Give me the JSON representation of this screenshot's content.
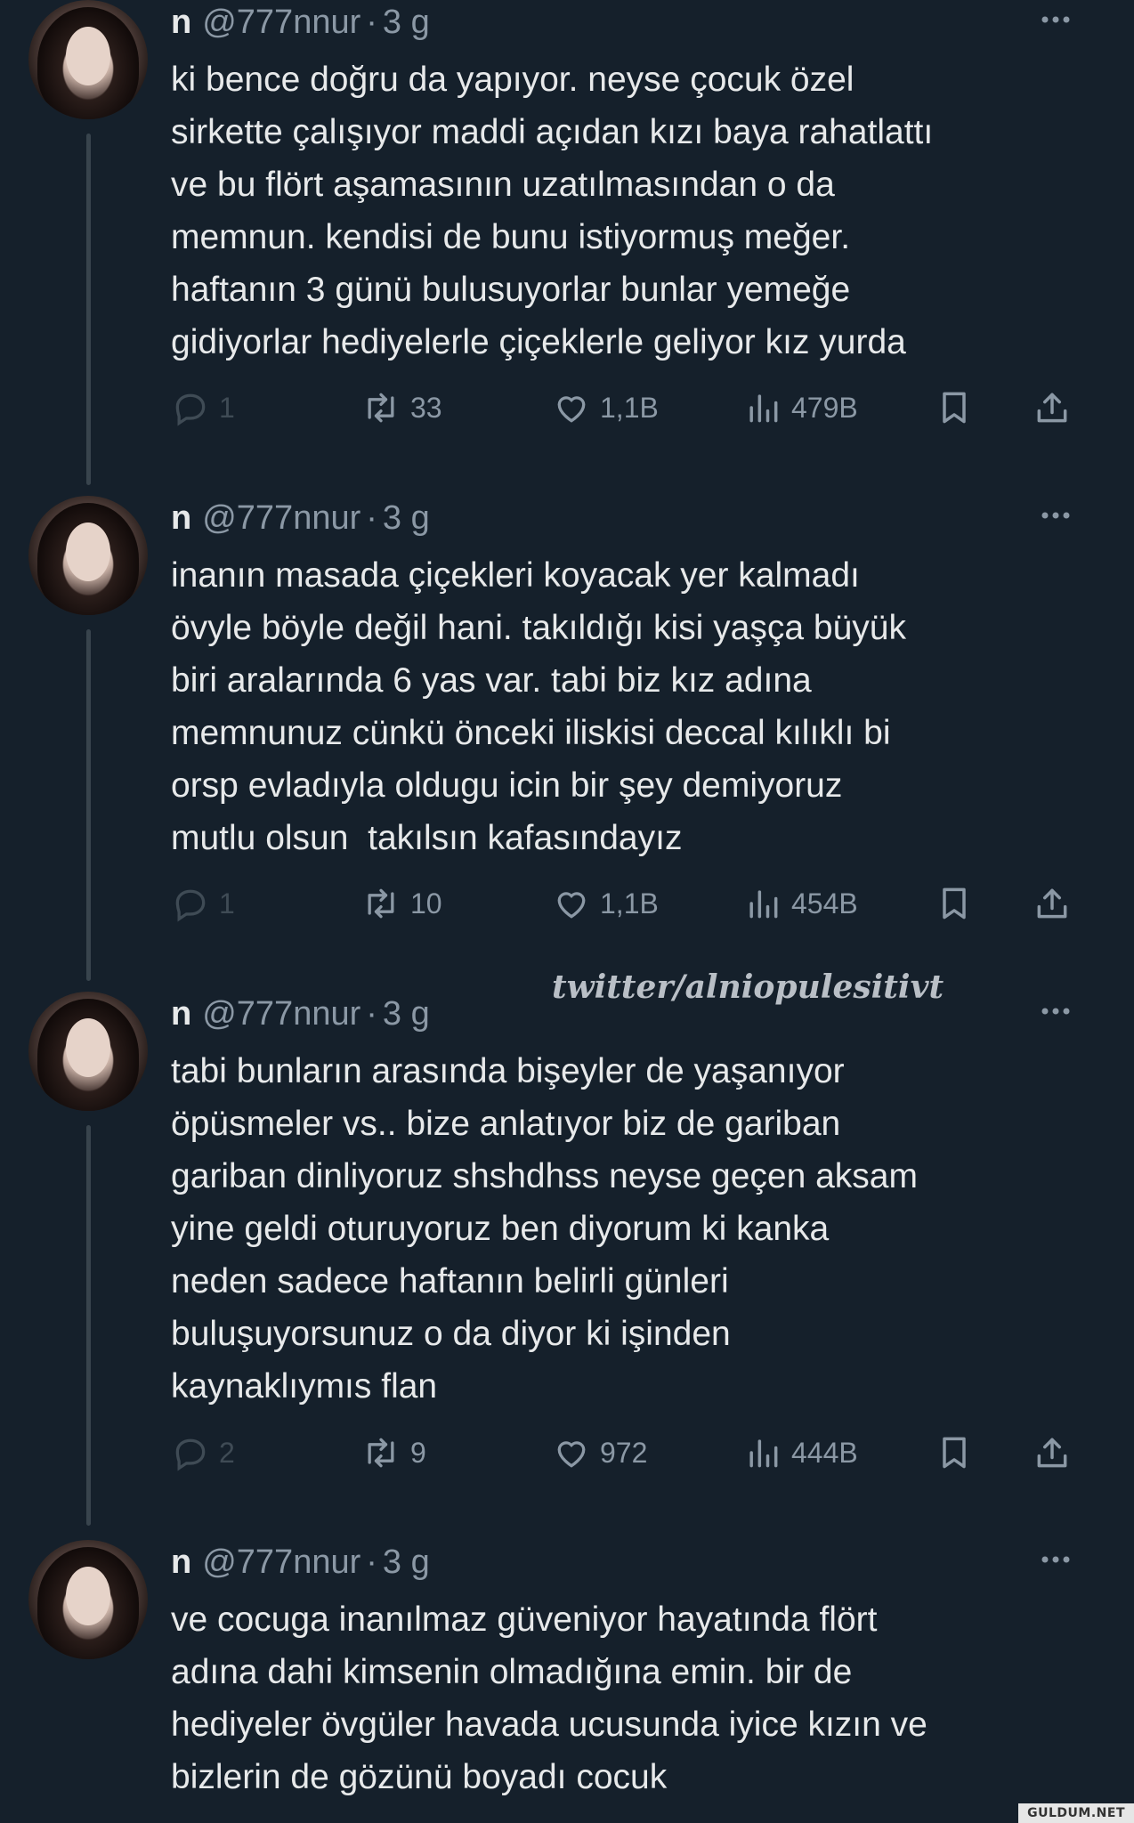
{
  "tweets": [
    {
      "name": "n",
      "handle": "@777nnur",
      "separator": "·",
      "time": "3 g",
      "text": "ki bence doğru da yapıyor. neyse çocuk özel\nsirkette çalışıyor maddi açıdan kızı baya rahatlattı\nve bu flört aşamasının uzatılmasından o da\nmemnun. kendisi de bunu istiyormuş meğer.\nhaftanın 3 günü bulusuyorlar bunlar yemeğe\ngidiyorlar hediyelerle çiçeklerle geliyor kız yurda",
      "replies": "1",
      "retweets": "33",
      "likes": "1,1B",
      "views": "479B"
    },
    {
      "name": "n",
      "handle": "@777nnur",
      "separator": "·",
      "time": "3 g",
      "text": "inanın masada çiçekleri koyacak yer kalmadı\növyle böyle değil hani. takıldığı kisi yaşça büyük\nbiri aralarında 6 yas var. tabi biz kız adına\nmemnunuz cünkü önceki iliskisi deccal kılıklı bi\norsp evladıyla oldugu icin bir şey demiyoruz\nmutlu olsun  takılsın kafasındayız",
      "replies": "1",
      "retweets": "10",
      "likes": "1,1B",
      "views": "454B"
    },
    {
      "name": "n",
      "handle": "@777nnur",
      "separator": "·",
      "time": "3 g",
      "text": "tabi bunların arasında bişeyler de yaşanıyor\nöpüsmeler vs.. bize anlatıyor biz de gariban\ngariban dinliyoruz shshdhss neyse geçen aksam\nyine geldi oturuyoruz ben diyorum ki kanka\nneden sadece haftanın belirli günleri\nbuluşuyorsunuz o da diyor ki işinden\nkaynaklıymıs flan",
      "replies": "2",
      "retweets": "9",
      "likes": "972",
      "views": "444B"
    },
    {
      "name": "n",
      "handle": "@777nnur",
      "separator": "·",
      "time": "3 g",
      "text": "ve cocuga inanılmaz güveniyor hayatında flört\nadına dahi kimsenin olmadığına emin. bir de\nhediyeler övgüler havada ucusunda iyice kızın ve\nbizlerin de gözünü boyadı cocuk"
    }
  ],
  "watermark": "twitter/alniopulesitivt",
  "corner_badge": "GULDUM.NET",
  "colors": {
    "background": "#15202b",
    "text": "#e7e9ea",
    "muted": "#8b98a5",
    "thread_line": "#38444d"
  },
  "icons": [
    "reply-icon",
    "retweet-icon",
    "like-icon",
    "views-icon",
    "bookmark-icon",
    "share-icon",
    "more-icon"
  ]
}
